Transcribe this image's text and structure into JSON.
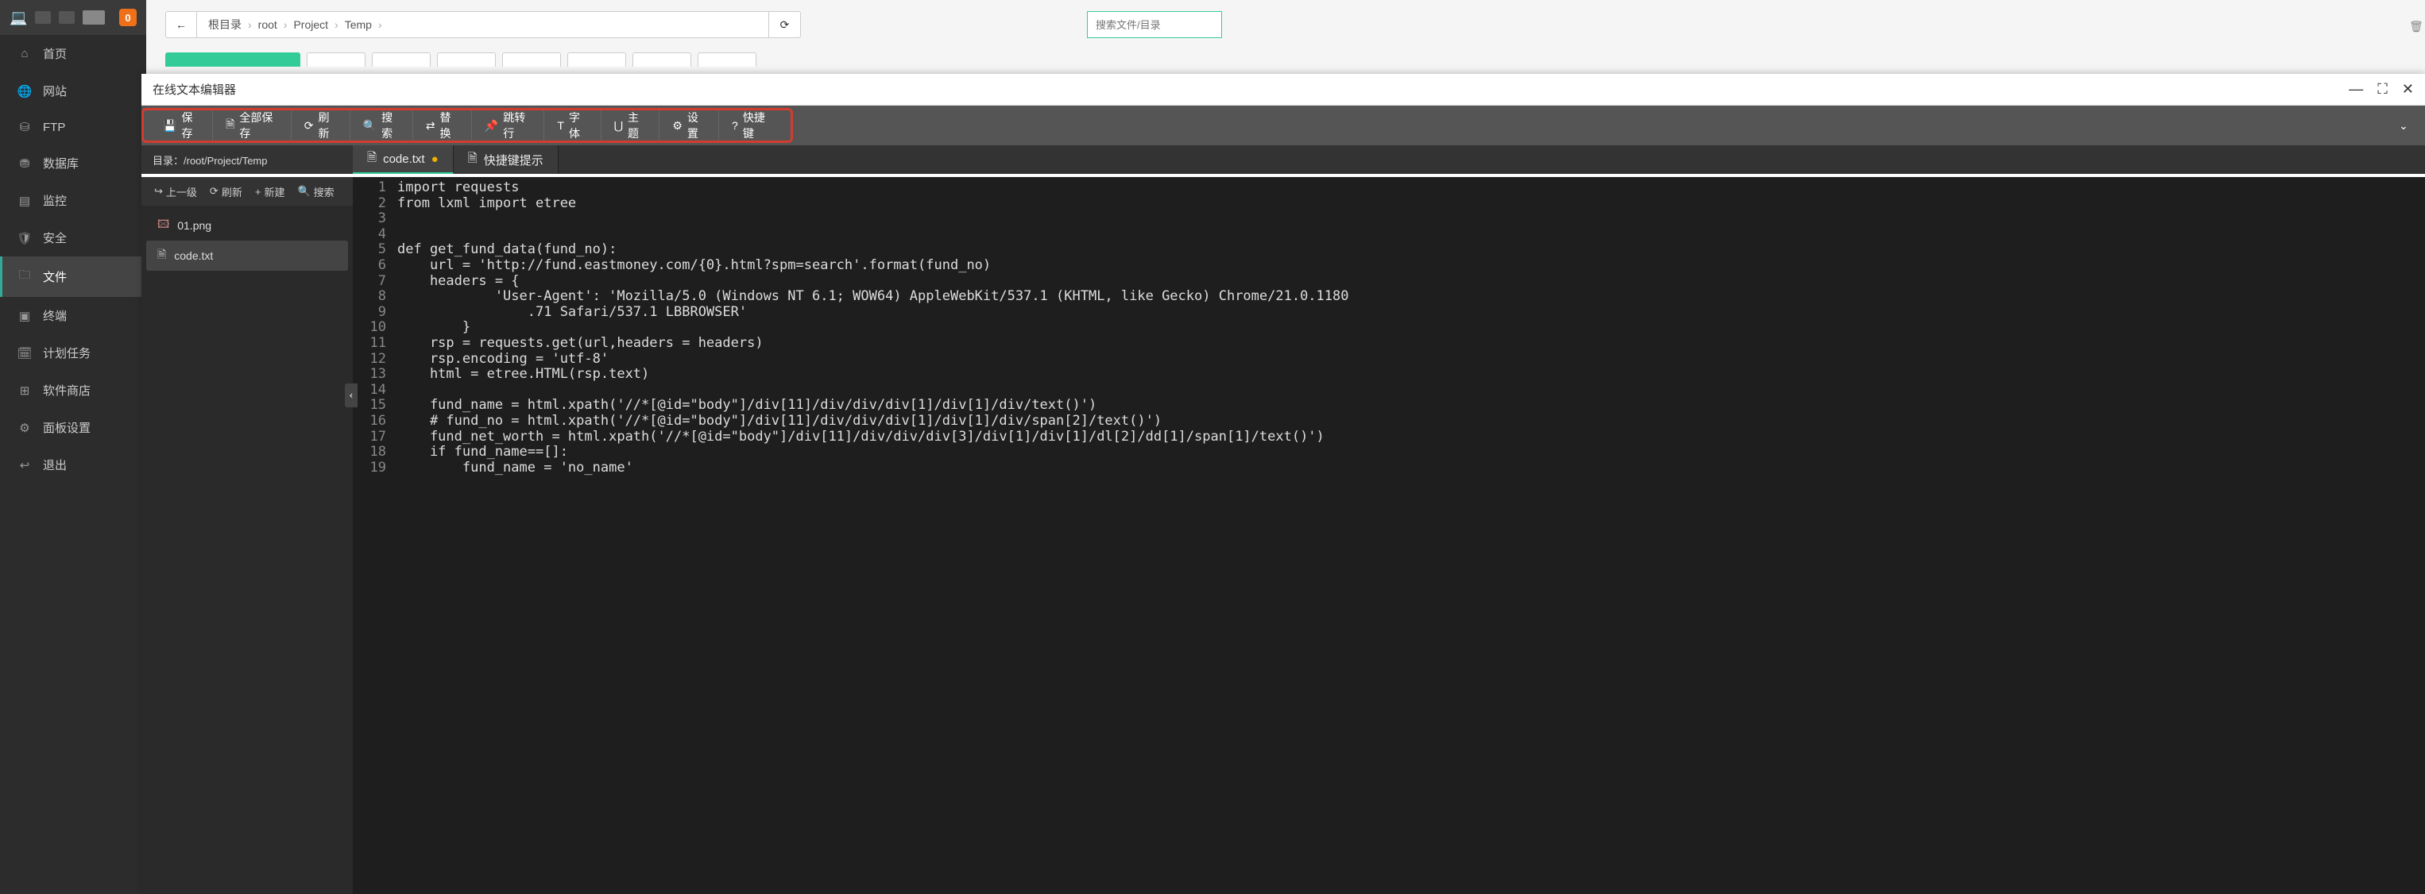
{
  "sidebar": {
    "badge": "0",
    "items": [
      {
        "label": "首页",
        "icon": "⌂"
      },
      {
        "label": "网站",
        "icon": "⊞"
      },
      {
        "label": "FTP",
        "icon": "⛁"
      },
      {
        "label": "数据库",
        "icon": "⛃"
      },
      {
        "label": "监控",
        "icon": "▤"
      },
      {
        "label": "安全",
        "icon": "🛡"
      },
      {
        "label": "文件",
        "icon": "🗀"
      },
      {
        "label": "终端",
        "icon": "▣"
      },
      {
        "label": "计划任务",
        "icon": "🗓"
      },
      {
        "label": "软件商店",
        "icon": "⊟"
      },
      {
        "label": "面板设置",
        "icon": "⚙"
      },
      {
        "label": "退出",
        "icon": "↩"
      }
    ]
  },
  "breadcrumb": {
    "items": [
      "根目录",
      "root",
      "Project",
      "Temp"
    ]
  },
  "search": {
    "placeholder": "搜索文件/目录"
  },
  "editor": {
    "title": "在线文本编辑器",
    "toolbar": {
      "save": "保存",
      "save_all": "全部保存",
      "refresh": "刷新",
      "search": "搜索",
      "replace": "替换",
      "goto": "跳转行",
      "font": "字体",
      "theme": "主题",
      "settings": "设置",
      "shortcut": "快捷键"
    },
    "dir_label": "目录：/root/Project/Temp",
    "file_actions": {
      "up": "上一级",
      "refresh": "刷新",
      "new": "新建",
      "search": "搜索"
    },
    "files": [
      {
        "name": "01.png",
        "icon": "img"
      },
      {
        "name": "code.txt",
        "icon": "txt",
        "selected": true
      }
    ],
    "tabs": [
      {
        "name": "code.txt",
        "icon": "doc",
        "warn": true,
        "active": true
      },
      {
        "name": "快捷键提示",
        "icon": "doc",
        "active": false
      }
    ],
    "code_lines": [
      "import requests",
      "from lxml import etree",
      "",
      "",
      "def get_fund_data(fund_no):",
      "    url = 'http://fund.eastmoney.com/{0}.html?spm=search'.format(fund_no)",
      "    headers = {",
      "            'User-Agent': 'Mozilla/5.0 (Windows NT 6.1; WOW64) AppleWebKit/537.1 (KHTML, like Gecko) Chrome/21.0.1180",
      "                .71 Safari/537.1 LBBROWSER'",
      "        }",
      "    rsp = requests.get(url,headers = headers)",
      "    rsp.encoding = 'utf-8'",
      "    html = etree.HTML(rsp.text)",
      "",
      "    fund_name = html.xpath('//*[@id=\"body\"]/div[11]/div/div/div[1]/div[1]/div/text()')",
      "    # fund_no = html.xpath('//*[@id=\"body\"]/div[11]/div/div/div[1]/div[1]/div/span[2]/text()')",
      "    fund_net_worth = html.xpath('//*[@id=\"body\"]/div[11]/div/div/div[3]/div[1]/div[1]/dl[2]/dd[1]/span[1]/text()')",
      "    if fund_name==[]:",
      "        fund_name = 'no_name'"
    ]
  }
}
